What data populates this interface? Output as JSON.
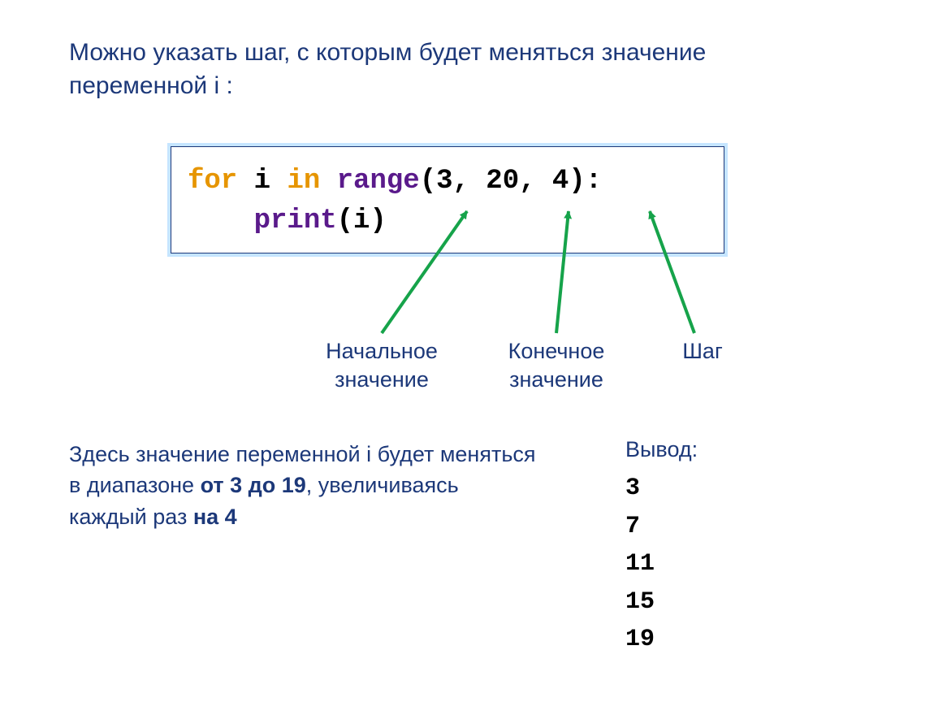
{
  "heading": "Можно указать шаг, с которым будет меняться значение переменной i :",
  "code": {
    "for": "for",
    "i": " i ",
    "in": "in",
    "sp": " ",
    "range": "range",
    "args": "(3, 20, 4):",
    "indent": "    ",
    "print": "print",
    "printarg": "(i)"
  },
  "labels": {
    "start": "Начальное значение",
    "end": "Конечное значение",
    "step": "Шаг"
  },
  "explain": {
    "p1": "Здесь значение переменной i будет меняться в диапазоне ",
    "b1": "от 3 до 19",
    "p2": ", увеличиваясь каждый раз ",
    "b2": "на 4"
  },
  "output": {
    "title": "Вывод:",
    "lines": "3\n7\n11\n15\n19"
  }
}
